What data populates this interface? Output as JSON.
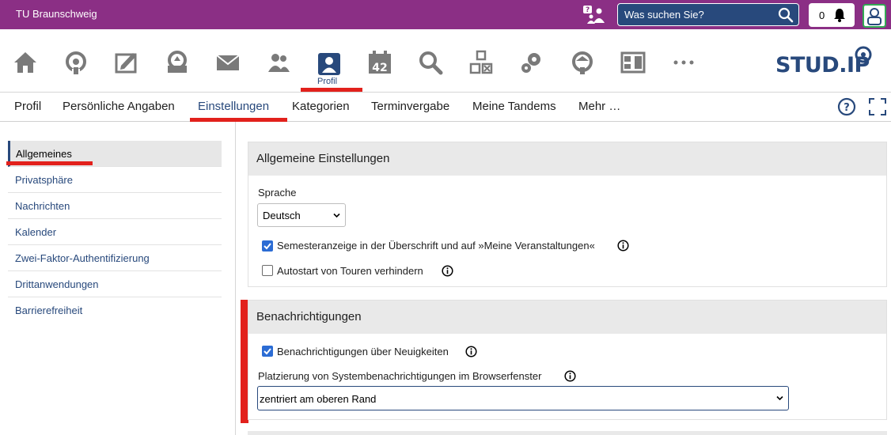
{
  "site_name": "TU Braunschweig",
  "search": {
    "placeholder": "Was suchen Sie?"
  },
  "notifications": {
    "count": "0"
  },
  "nav_icons": [
    "home-icon",
    "meeting-icon",
    "document-icon",
    "tools-icon",
    "mail-icon",
    "community-icon",
    "profile-icon",
    "calendar-icon",
    "search-icon",
    "resources-icon",
    "admin-icon",
    "export-icon",
    "schedule-icon",
    "more-icon"
  ],
  "nav_active_label": "Profil",
  "calendar_day": "42",
  "logo_text": "STUD.IP",
  "tabs": [
    "Profil",
    "Persönliche Angaben",
    "Einstellungen",
    "Kategorien",
    "Terminvergabe",
    "Meine Tandems",
    "Mehr …"
  ],
  "active_tab": "Einstellungen",
  "sidebar": {
    "items": [
      "Allgemeines",
      "Privatsphäre",
      "Nachrichten",
      "Kalender",
      "Zwei-Faktor-Authentifizierung",
      "Drittanwendungen",
      "Barrierefreiheit"
    ],
    "active": "Allgemeines"
  },
  "general": {
    "title": "Allgemeine Einstellungen",
    "language_label": "Sprache",
    "language_value": "Deutsch",
    "semester_label": "Semesteranzeige in der Überschrift und auf »Meine Veranstaltungen«",
    "semester_checked": true,
    "autostart_label": "Autostart von Touren verhindern",
    "autostart_checked": false
  },
  "notifications_panel": {
    "title": "Benachrichtigungen",
    "news_label": "Benachrichtigungen über Neuigkeiten",
    "news_checked": true,
    "placement_label": "Platzierung von Systembenachrichtigungen im Browserfenster",
    "placement_value": "zentriert am oberen Rand"
  },
  "colors": {
    "brand": "#8b2f85",
    "accent": "#28497c",
    "highlight": "#e2211c",
    "checkbox": "#2b6cd4"
  }
}
